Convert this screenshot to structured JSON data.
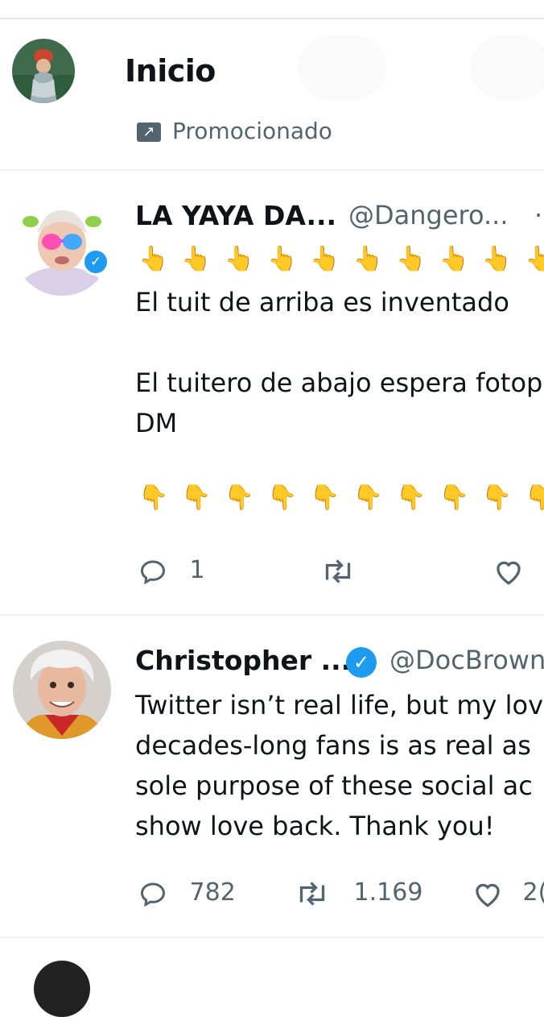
{
  "header": {
    "title": "Inicio",
    "promoted_label": "Promocionado",
    "promoted_icon": "promoted-icon"
  },
  "tweets": [
    {
      "name": "LA YAYA DA...",
      "handle": "@Dangero...",
      "more": "·",
      "verified": true,
      "text_up": "👆👆👆👆👆👆👆👆👆👆",
      "text": "El tuit de arriba es inventado\n\nEl tuitero de abajo espera fotop\nDM",
      "text_down": "👇👇👇👇👇👇👇👇👇👇",
      "reply_count": "1",
      "retweet_count": "",
      "like_count": ""
    },
    {
      "name": "Christopher ...",
      "handle": "@DocBrown",
      "verified": true,
      "text": "Twitter isn’t real life, but my lov\ndecades-long fans is as real as\nsole purpose of these social ac\nshow love back. Thank you!",
      "reply_count": "782",
      "retweet_count": "1.169",
      "like_count": "2("
    }
  ],
  "colors": {
    "accent": "#1d9bf0",
    "muted": "#536471",
    "divider": "#eff3f4"
  }
}
